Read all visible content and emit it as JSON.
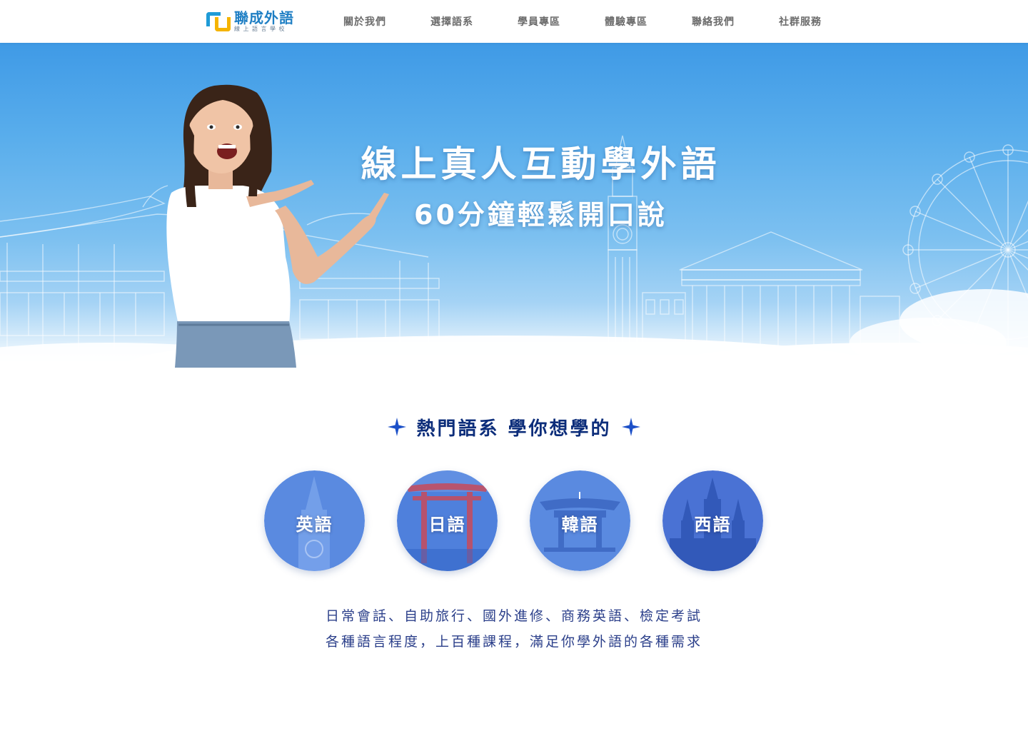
{
  "header": {
    "logo_name": "聯成外語",
    "logo_sub": "線上語言學校",
    "nav": [
      {
        "label": "關於我們"
      },
      {
        "label": "選擇語系"
      },
      {
        "label": "學員專區"
      },
      {
        "label": "體驗專區"
      },
      {
        "label": "聯絡我們"
      },
      {
        "label": "社群服務"
      }
    ]
  },
  "hero": {
    "title": "線上真人互動學外語",
    "subtitle": "60分鐘輕鬆開口說"
  },
  "section": {
    "title": "熱門語系 學你想學的",
    "languages": [
      {
        "label": "英語"
      },
      {
        "label": "日語"
      },
      {
        "label": "韓語"
      },
      {
        "label": "西語"
      }
    ],
    "desc_line1": "日常會話、自助旅行、國外進修、商務英語、檢定考試",
    "desc_line2": "各種語言程度，上百種課程，滿足你學外語的各種需求"
  },
  "colors": {
    "brand_blue": "#1f7fc4",
    "brand_yellow": "#f5b400",
    "section_title": "#0c2d7a",
    "circle_blue": "#4a7fd8"
  }
}
